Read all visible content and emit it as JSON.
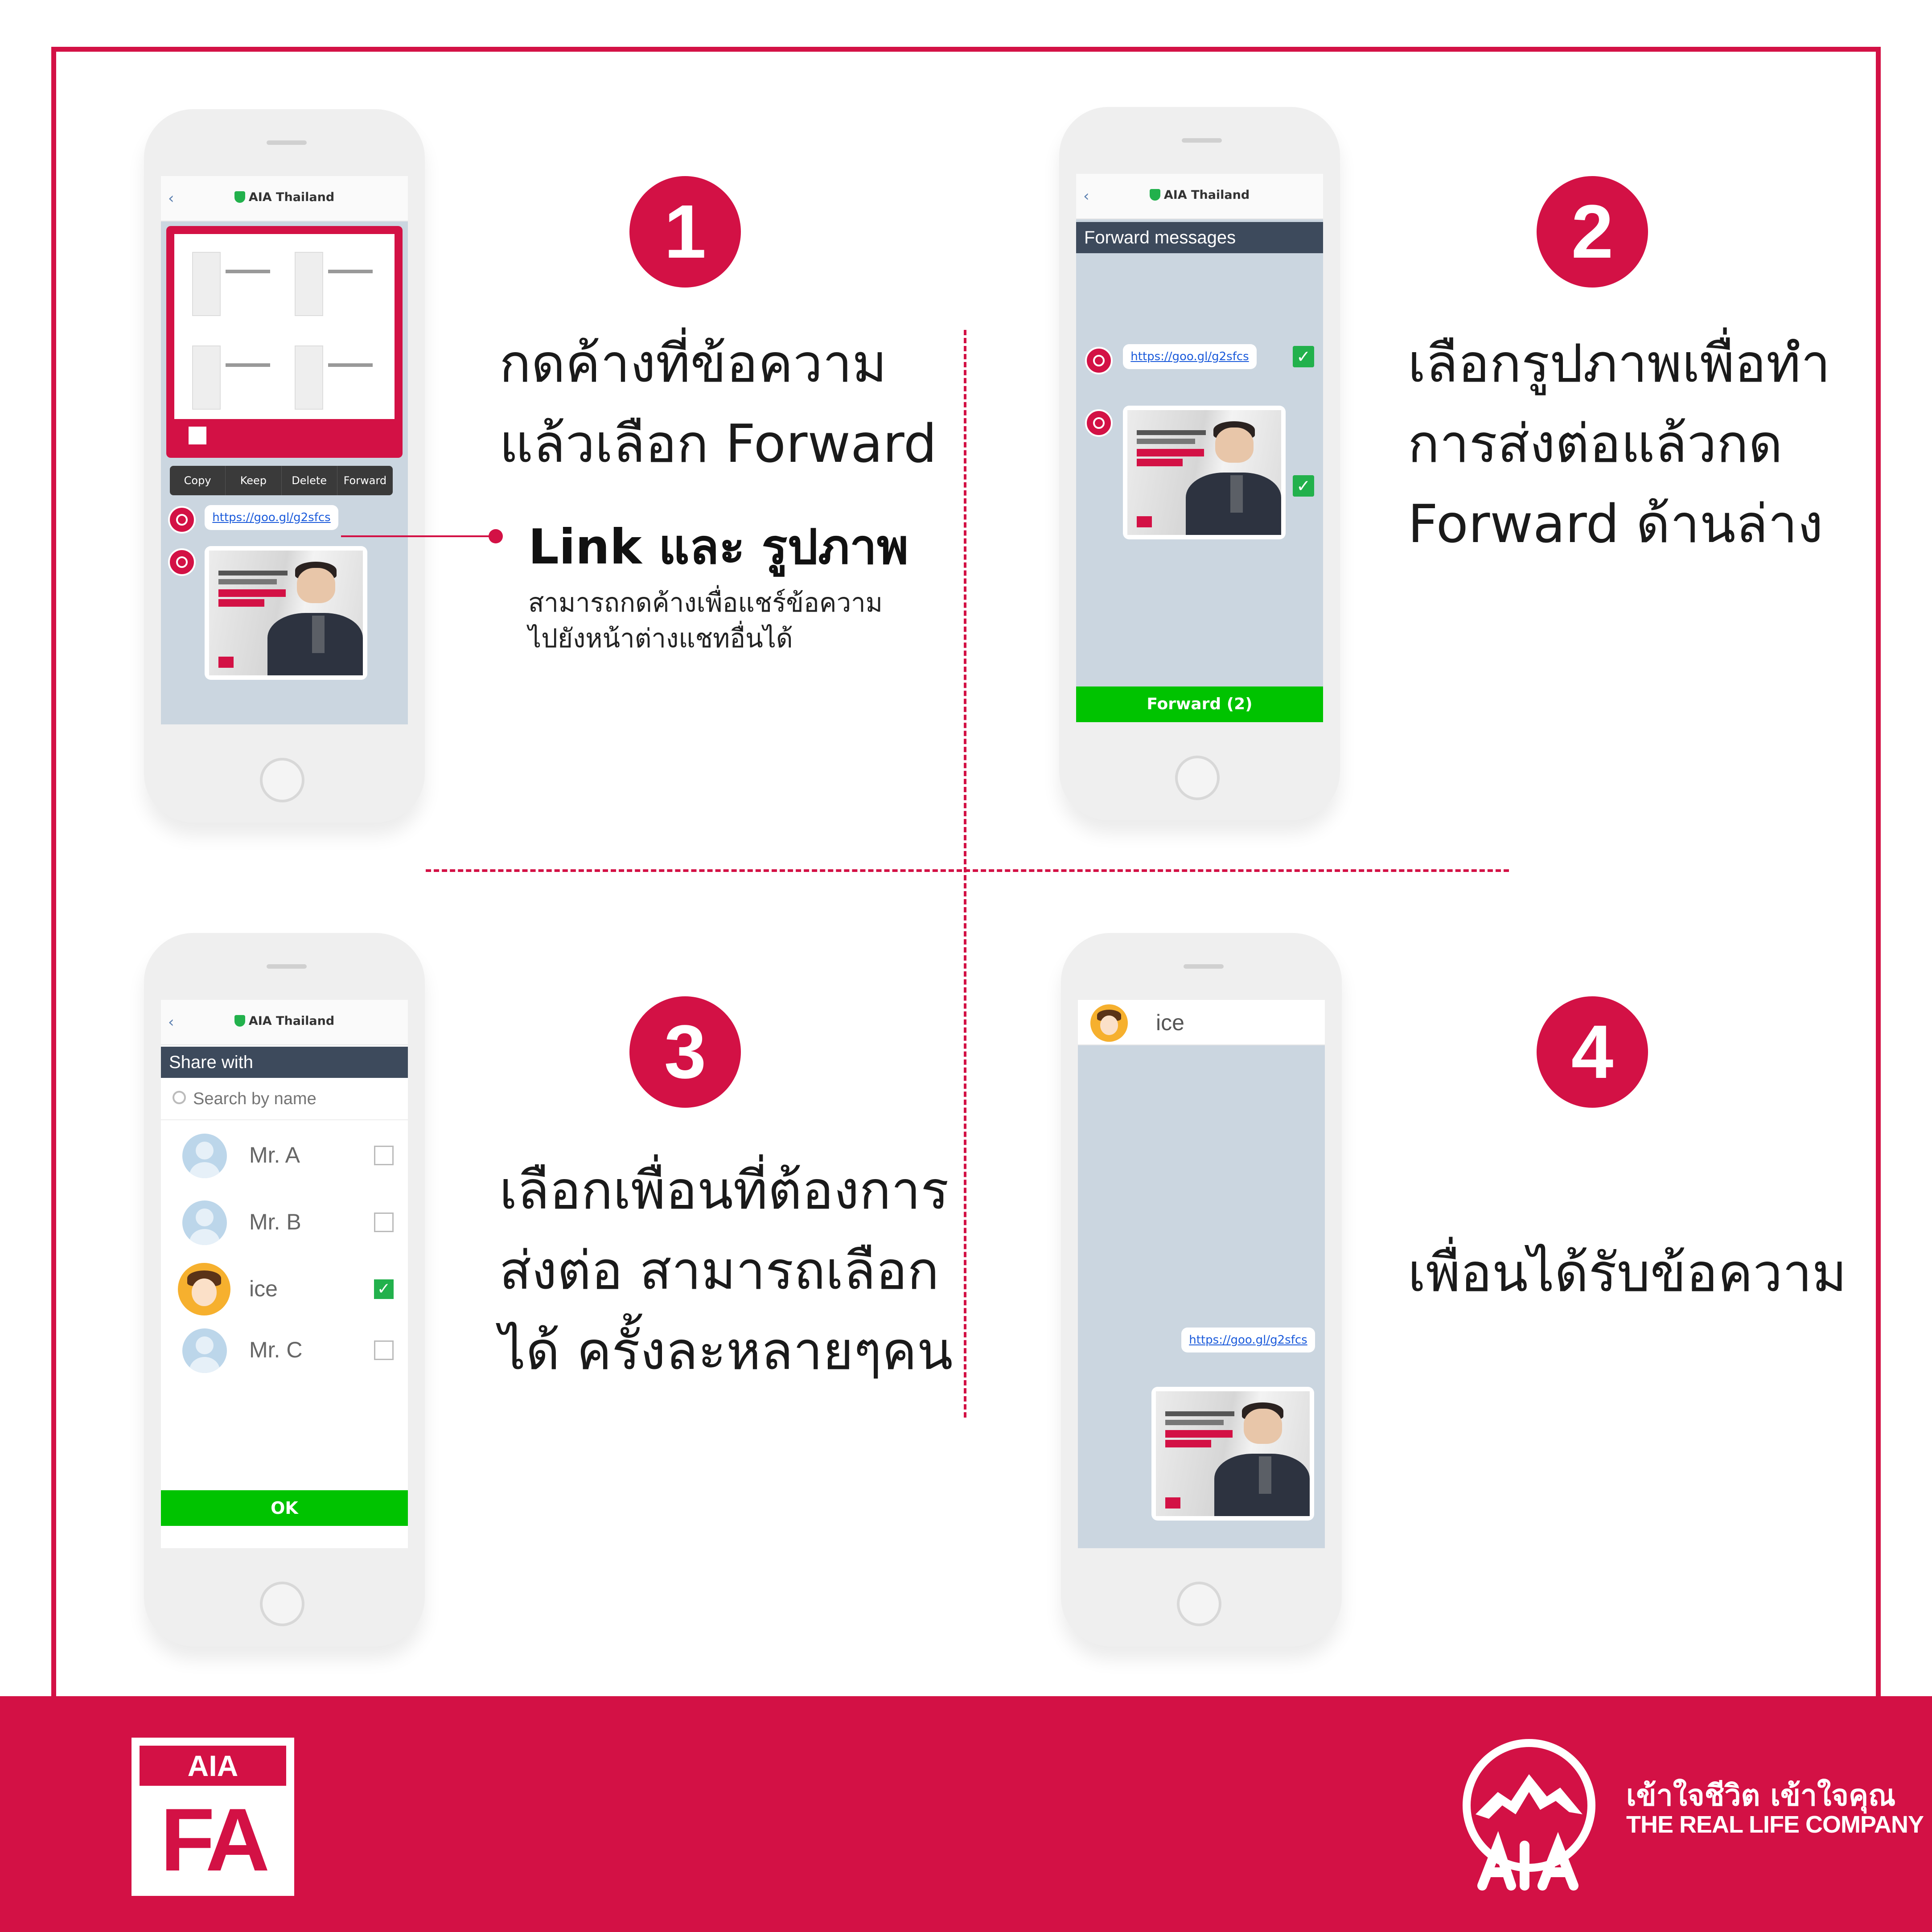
{
  "colors": {
    "brand_red": "#d31145",
    "line_green": "#00c300",
    "check_green": "#22b14c"
  },
  "steps": {
    "s1": {
      "number": "1",
      "text": "กดค้างที่ข้อความ\nแล้วเลือก Forward"
    },
    "s2": {
      "number": "2",
      "text": "เลือกรูปภาพเพื่อทำ\nการส่งต่อแล้วกด\nForward ด้านล่าง"
    },
    "s3": {
      "number": "3",
      "text": "เลือกเพื่อนที่ต้องการ\nส่งต่อ สามารถเลือก\nได้ ครั้งละหลายๆคน"
    },
    "s4": {
      "number": "4",
      "text": "เพื่อนได้รับข้อความ"
    }
  },
  "callout": {
    "title": "Link และ รูปภาพ",
    "desc_line1": "สามารถกดค้างเพื่อแชร์ข้อความ",
    "desc_line2": "ไปยังหน้าต่างแชทอื่นได้"
  },
  "phone1": {
    "chat_title": "AIA Thailand",
    "context_menu": [
      "Copy",
      "Keep",
      "Delete",
      "Forward"
    ],
    "link": "https://goo.gl/g2sfcs"
  },
  "phone2": {
    "chat_title": "AIA Thailand",
    "header": "Forward messages",
    "link": "https://goo.gl/g2sfcs",
    "button": "Forward (2)"
  },
  "phone3": {
    "chat_title": "AIA Thailand",
    "header": "Share with",
    "search_placeholder": "Search by name",
    "contacts": [
      {
        "name": "Mr. A",
        "checked": false
      },
      {
        "name": "Mr. B",
        "checked": false
      },
      {
        "name": "ice",
        "checked": true
      },
      {
        "name": "Mr. C",
        "checked": false
      }
    ],
    "ok": "OK"
  },
  "phone4": {
    "contact_name": "ice",
    "link": "https://goo.gl/g2sfcs"
  },
  "footer": {
    "fa_top": "AIA",
    "fa_big": "FA",
    "tagline_th": "เข้าใจชีวิต เข้าใจคุณ",
    "tagline_en": "THE REAL LIFE COMPANY"
  }
}
